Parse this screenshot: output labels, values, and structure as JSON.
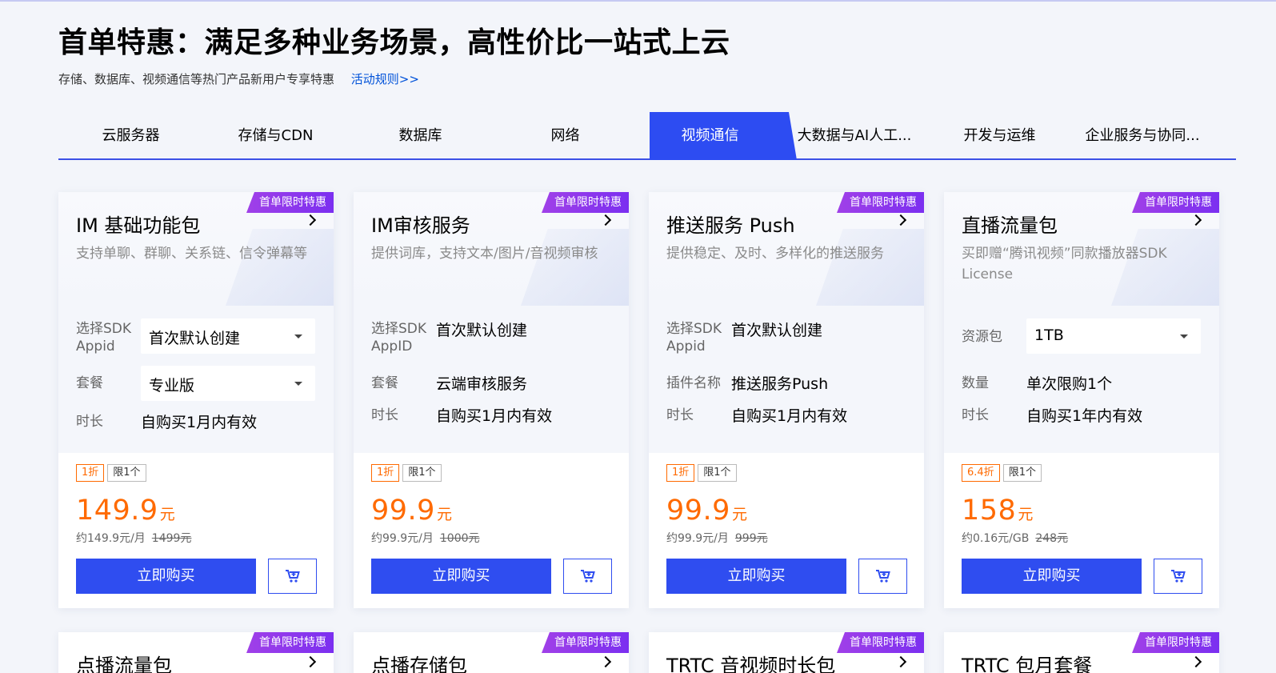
{
  "page": {
    "headline": "首单特惠：满足多种业务场景，高性价比一站式上云",
    "subtitle": "存储、数据库、视频通信等热门产品新用户专享特惠",
    "rules_link": "活动规则>>"
  },
  "tabs": [
    {
      "label": "云服务器"
    },
    {
      "label": "存储与CDN"
    },
    {
      "label": "数据库"
    },
    {
      "label": "网络"
    },
    {
      "label": "视频通信",
      "active": true
    },
    {
      "label": "大数据与AI人工..."
    },
    {
      "label": "开发与运维"
    },
    {
      "label": "企业服务与协同..."
    }
  ],
  "colors": {
    "accent": "#2f4df0",
    "price": "#ff6a00",
    "badge": "#8a33ec",
    "link": "#0052d9"
  },
  "cards": [
    {
      "badge": "首单限时特惠",
      "title": "IM 基础功能包",
      "desc": "支持单聊、群聊、关系链、信令弹幕等",
      "rows": [
        {
          "label": "选择SDK Appid",
          "value": "首次默认创建",
          "type": "select"
        },
        {
          "label": "套餐",
          "value": "专业版",
          "type": "select"
        },
        {
          "label": "时长",
          "value": "自购买1月内有效",
          "type": "text"
        }
      ],
      "discount": "1折",
      "limit": "限1个",
      "price": "149.9",
      "unit": "元",
      "per": "约149.9元/月",
      "original": "1499元",
      "buy": "立即购买"
    },
    {
      "badge": "首单限时特惠",
      "title": "IM审核服务",
      "desc": "提供词库，支持文本/图片/音视频审核",
      "rows": [
        {
          "label": "选择SDK AppID",
          "value": "首次默认创建",
          "type": "text"
        },
        {
          "label": "套餐",
          "value": "云端审核服务",
          "type": "text"
        },
        {
          "label": "时长",
          "value": "自购买1月内有效",
          "type": "text"
        }
      ],
      "discount": "1折",
      "limit": "限1个",
      "price": "99.9",
      "unit": "元",
      "per": "约99.9元/月",
      "original": "1000元",
      "buy": "立即购买"
    },
    {
      "badge": "首单限时特惠",
      "title": "推送服务 Push",
      "desc": "提供稳定、及时、多样化的推送服务",
      "rows": [
        {
          "label": "选择SDK Appid",
          "value": "首次默认创建",
          "type": "text"
        },
        {
          "label": "插件名称",
          "value": "推送服务Push",
          "type": "text"
        },
        {
          "label": "时长",
          "value": "自购买1月内有效",
          "type": "text"
        }
      ],
      "discount": "1折",
      "limit": "限1个",
      "price": "99.9",
      "unit": "元",
      "per": "约99.9元/月",
      "original": "999元",
      "buy": "立即购买"
    },
    {
      "badge": "首单限时特惠",
      "title": "直播流量包",
      "desc": "买即赠“腾讯视频”同款播放器SDK License",
      "rows": [
        {
          "label": "资源包",
          "value": "1TB",
          "type": "select"
        },
        {
          "label": "数量",
          "value": "单次限购1个",
          "type": "text"
        },
        {
          "label": "时长",
          "value": "自购买1年内有效",
          "type": "text"
        }
      ],
      "discount": "6.4折",
      "limit": "限1个",
      "price": "158",
      "unit": "元",
      "per": "约0.16元/GB",
      "original": "248元",
      "buy": "立即购买"
    }
  ],
  "next_row": [
    {
      "badge": "首单限时特惠",
      "title": "点播流量包"
    },
    {
      "badge": "首单限时特惠",
      "title": "点播存储包"
    },
    {
      "badge": "首单限时特惠",
      "title": "TRTC 音视频时长包"
    },
    {
      "badge": "首单限时特惠",
      "title": "TRTC 包月套餐"
    }
  ]
}
